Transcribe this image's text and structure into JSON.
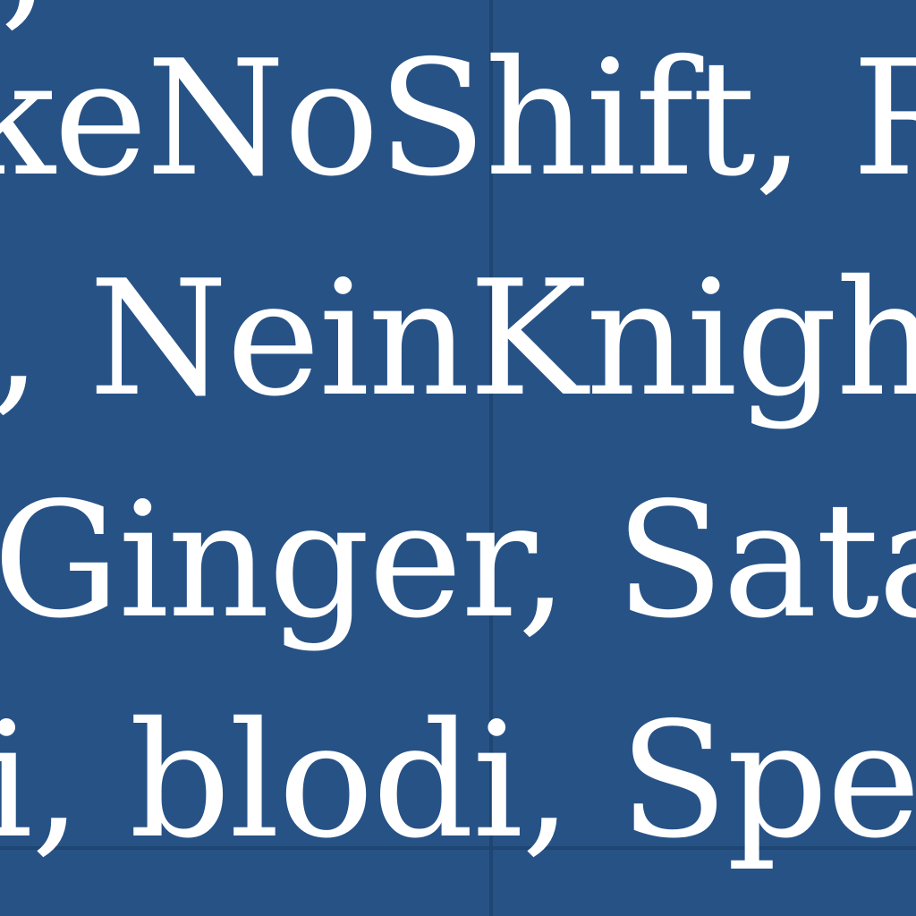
{
  "theme": {
    "background": "#275286",
    "text": "#ffffff",
    "divider": "#1f446f"
  },
  "lines": [
    ";",
    "keNoShift, Re",
    ", NeinKnigh",
    "Ginger, Satan",
    "i, blodi, Spee"
  ]
}
